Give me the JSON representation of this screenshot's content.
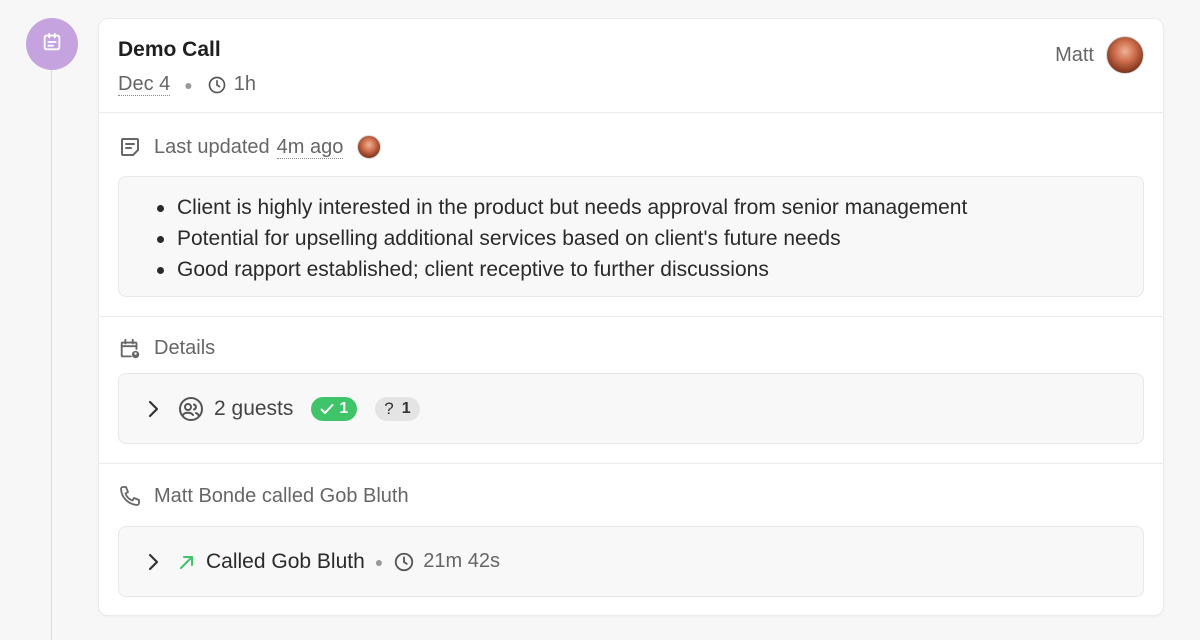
{
  "event": {
    "icon": "calendar-icon",
    "icon_color": "#c5a3de",
    "title": "Demo Call",
    "date": "Dec 4",
    "duration": "1h",
    "owner": "Matt"
  },
  "notes": {
    "prefix": "Last updated",
    "time_ago": "4m ago",
    "items": [
      "Client is highly interested in the product but needs approval from senior management",
      "Potential for upselling additional services based on client's future needs",
      "Good rapport established; client receptive to further discussions"
    ]
  },
  "details": {
    "label": "Details",
    "guests_label": "2 guests",
    "accepted_count": "1",
    "pending_count": "1",
    "pending_symbol": "?",
    "accepted_color": "#3fc46a"
  },
  "call": {
    "header": "Matt Bonde called Gob Bluth",
    "summary": "Called Gob Bluth",
    "duration": "21m 42s",
    "arrow_color": "#3fc46a"
  }
}
